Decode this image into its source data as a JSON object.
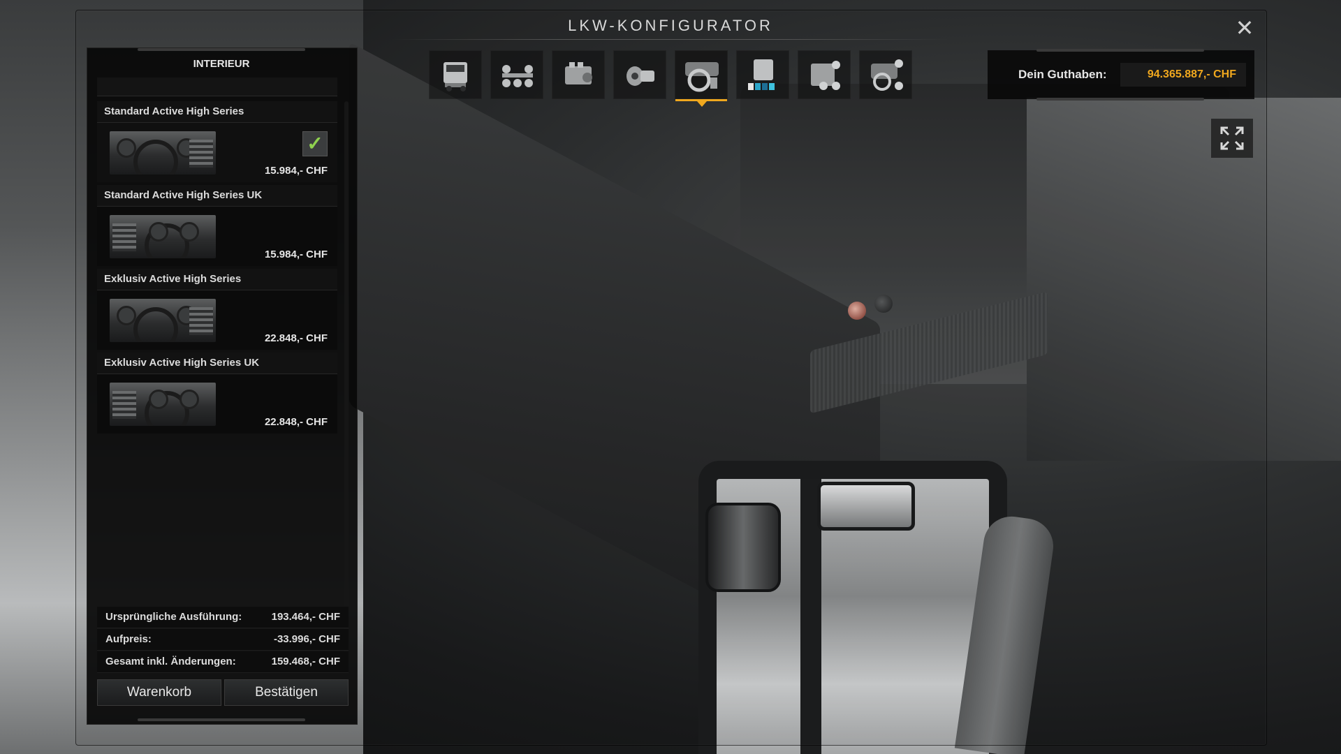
{
  "title": "LKW-KONFIGURATOR",
  "panel": {
    "header": "INTERIEUR",
    "options": [
      {
        "name": "Standard Active High Series",
        "price": "15.984,- CHF",
        "selected": true
      },
      {
        "name": "Standard Active High Series UK",
        "price": "15.984,- CHF",
        "selected": false
      },
      {
        "name": "Exklusiv Active High Series",
        "price": "22.848,- CHF",
        "selected": false
      },
      {
        "name": "Exklusiv Active High Series UK",
        "price": "22.848,- CHF",
        "selected": false
      }
    ],
    "summary": [
      {
        "label": "Ursprüngliche Ausführung:",
        "value": "193.464,- CHF"
      },
      {
        "label": "Aufpreis:",
        "value": "-33.996,- CHF"
      },
      {
        "label": "Gesamt inkl. Änderungen:",
        "value": "159.468,- CHF"
      }
    ],
    "buttons": {
      "cart": "Warenkorb",
      "confirm": "Bestätigen"
    }
  },
  "toolbar": {
    "items": [
      {
        "icon": "truck-cab-icon"
      },
      {
        "icon": "chassis-icon"
      },
      {
        "icon": "engine-icon"
      },
      {
        "icon": "transmission-icon"
      },
      {
        "icon": "interior-icon",
        "active": true
      },
      {
        "icon": "paint-icon"
      },
      {
        "icon": "accessories-icon"
      },
      {
        "icon": "interior-accessories-icon"
      }
    ]
  },
  "balance": {
    "label": "Dein Guthaben:",
    "value": "94.365.887,- CHF"
  },
  "colors": {
    "accent": "#f0a81e",
    "check": "#8fd14f"
  }
}
